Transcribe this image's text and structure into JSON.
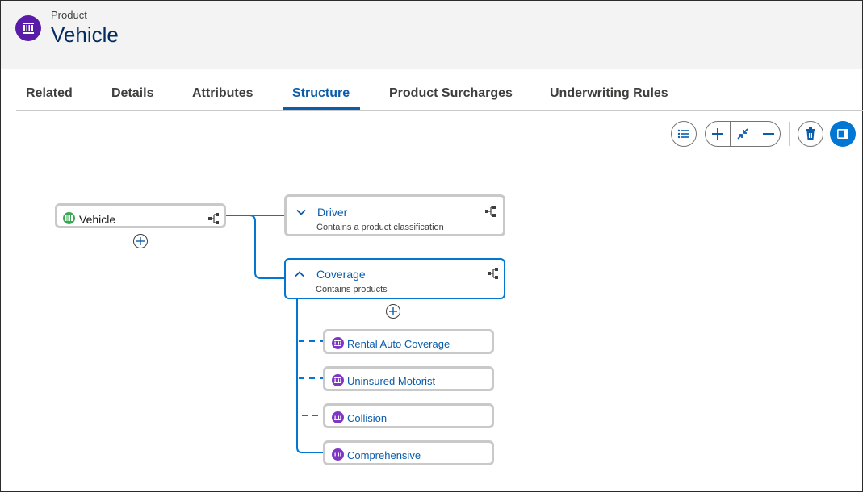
{
  "header": {
    "object_type": "Product",
    "object_name": "Vehicle",
    "icon": "product-barcode-icon",
    "icon_color": "#5a1ba9"
  },
  "tabs": [
    {
      "label": "Related"
    },
    {
      "label": "Details"
    },
    {
      "label": "Attributes"
    },
    {
      "label": "Structure",
      "active": true
    },
    {
      "label": "Product Surcharges"
    },
    {
      "label": "Underwriting Rules"
    }
  ],
  "toolbar": {
    "buttons": [
      "list-view-icon",
      "add-icon",
      "collapse-icon",
      "minus-icon",
      "delete-icon",
      "side-panel-icon"
    ]
  },
  "tree": {
    "root": {
      "label": "Vehicle",
      "icon": "product-green-icon"
    },
    "driver": {
      "title": "Driver",
      "subtitle": "Contains a product classification",
      "expanded": false
    },
    "coverage": {
      "title": "Coverage",
      "subtitle": "Contains products",
      "expanded": true,
      "children": [
        {
          "label": "Rental Auto Coverage"
        },
        {
          "label": "Uninsured Motorist"
        },
        {
          "label": "Collision"
        },
        {
          "label": "Comprehensive"
        }
      ]
    }
  },
  "colors": {
    "accent": "#0176d3",
    "link": "#0b5cab",
    "title": "#032d60",
    "product_icon": "#7f36c7",
    "root_icon": "#3ba755",
    "border": "#c9c9c9"
  }
}
